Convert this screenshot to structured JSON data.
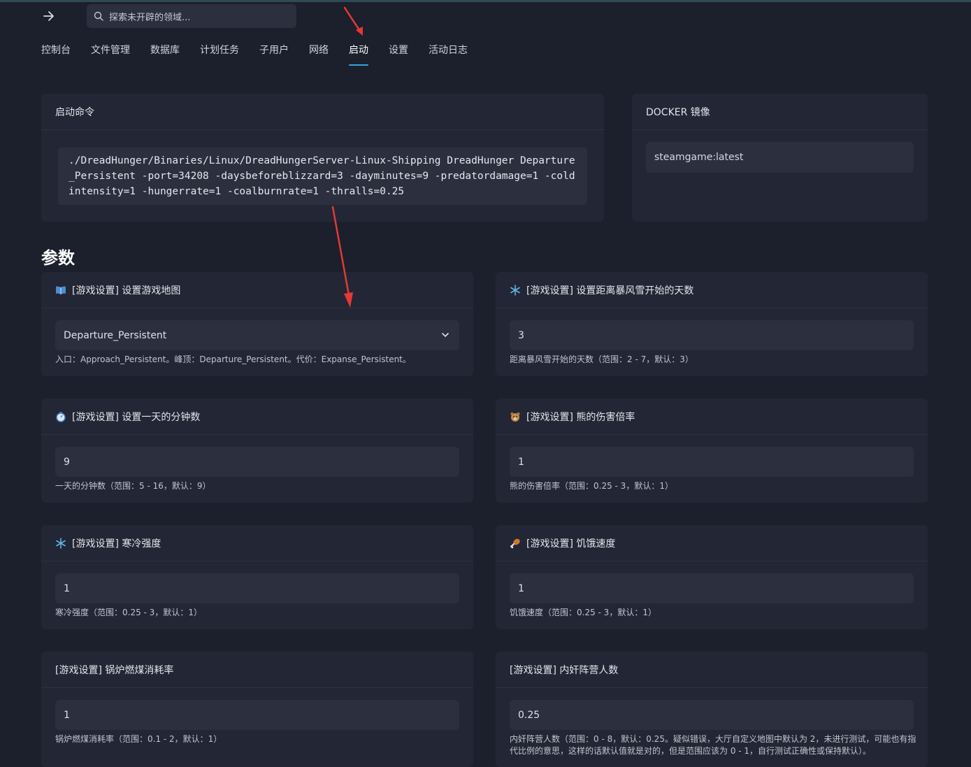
{
  "search": {
    "placeholder": "探索未开辟的领域..."
  },
  "nav": {
    "items": [
      {
        "label": "控制台"
      },
      {
        "label": "文件管理"
      },
      {
        "label": "数据库"
      },
      {
        "label": "计划任务"
      },
      {
        "label": "子用户"
      },
      {
        "label": "网络"
      },
      {
        "label": "启动"
      },
      {
        "label": "设置"
      },
      {
        "label": "活动日志"
      }
    ],
    "active": "启动"
  },
  "startup": {
    "title": "启动命令",
    "command": "./DreadHunger/Binaries/Linux/DreadHungerServer-Linux-Shipping DreadHunger Departure_Persistent -port=34208 -daysbeforeblizzard=3 -dayminutes=9 -predatordamage=1 -coldintensity=1 -hungerrate=1 -coalburnrate=1 -thralls=0.25"
  },
  "docker": {
    "title": "DOCKER 镜像",
    "value": "steamgame:latest"
  },
  "params": {
    "title": "参数",
    "items": [
      {
        "icon": "book-icon",
        "title": "[游戏设置] 设置游戏地图",
        "value": "Departure_Persistent",
        "desc": "入口：Approach_Persistent。峰顶：Departure_Persistent。代价：Expanse_Persistent。"
      },
      {
        "icon": "snowflake-icon",
        "title": "[游戏设置] 设置距离暴风雪开始的天数",
        "value": "3",
        "desc": "距离暴风雪开始的天数（范围：2 - 7，默认：3）"
      },
      {
        "icon": "stopwatch-icon",
        "title": "[游戏设置] 设置一天的分钟数",
        "value": "9",
        "desc": "一天的分钟数（范围：5 - 16，默认：9）"
      },
      {
        "icon": "bear-icon",
        "title": "[游戏设置] 熊的伤害倍率",
        "value": "1",
        "desc": "熊的伤害倍率（范围：0.25 - 3，默认：1）"
      },
      {
        "icon": "snowflake-icon",
        "title": "[游戏设置] 寒冷强度",
        "value": "1",
        "desc": "寒冷强度（范围：0.25 - 3，默认：1）"
      },
      {
        "icon": "drumstick-icon",
        "title": "[游戏设置] 饥饿速度",
        "value": "1",
        "desc": "饥饿速度（范围：0.25 - 3，默认：1）"
      },
      {
        "icon": "",
        "title": "[游戏设置] 锅炉燃煤消耗率",
        "value": "1",
        "desc": "锅炉燃煤消耗率（范围：0.1 - 2，默认：1）"
      },
      {
        "icon": "",
        "title": "[游戏设置] 内奸阵营人数",
        "value": "0.25",
        "desc": "内奸阵营人数（范围：0 - 8，默认：0.25。疑似错误，大厅自定义地图中默认为 2，未进行测试，可能也有指代比例的意思，这样的话默认值就是对的，但是范围应该为 0 - 1，自行测试正确性或保持默认）。"
      }
    ]
  }
}
